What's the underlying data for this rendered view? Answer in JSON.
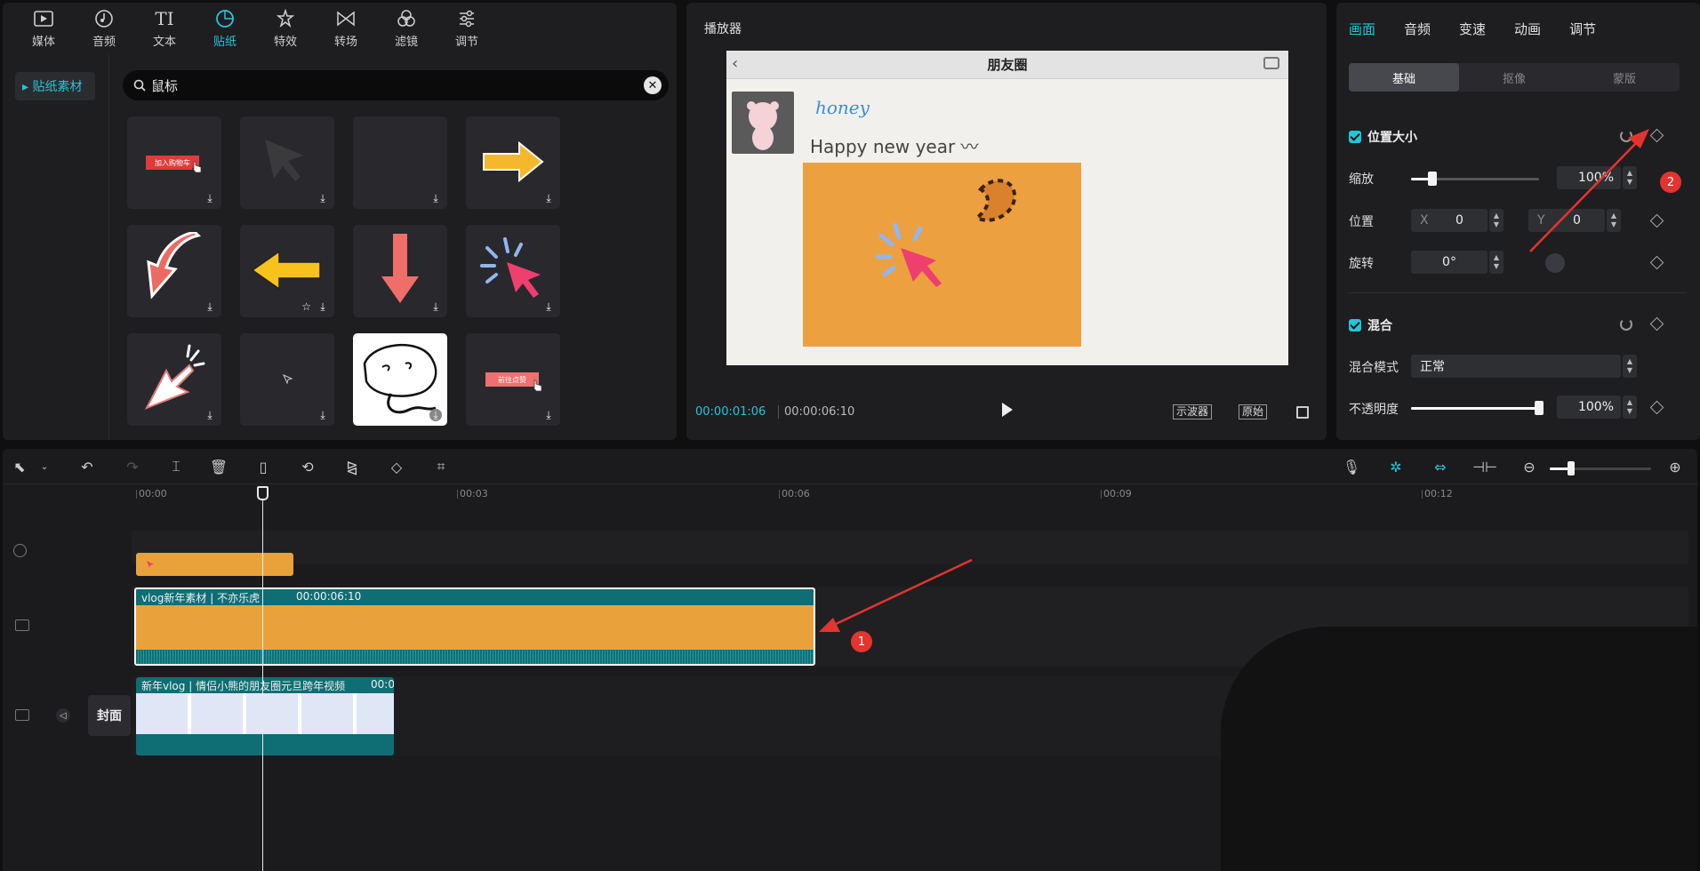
{
  "toolbar": {
    "tools": [
      {
        "label": "媒体",
        "icon": "media-icon"
      },
      {
        "label": "音频",
        "icon": "audio-icon"
      },
      {
        "label": "文本",
        "icon": "text-icon"
      },
      {
        "label": "贴纸",
        "icon": "sticker-icon",
        "active": true
      },
      {
        "label": "特效",
        "icon": "effects-icon"
      },
      {
        "label": "转场",
        "icon": "transition-icon"
      },
      {
        "label": "滤镜",
        "icon": "filter-icon"
      },
      {
        "label": "调节",
        "icon": "adjust-icon"
      }
    ]
  },
  "sidebar": {
    "active_item": "▸ 贴纸素材"
  },
  "search": {
    "query": "鼠标"
  },
  "stickers": {
    "tile_texts": [
      "加入购物车",
      "前往点赞"
    ]
  },
  "player": {
    "title": "播放器",
    "preview": {
      "header": "朋友圈",
      "name": "honey",
      "post_text": "Happy new year 〰"
    },
    "current_time": "00:00:01:06",
    "total_time": "00:00:06:10",
    "btn_scope": "示波器",
    "btn_original": "原始"
  },
  "props": {
    "tabs": [
      "画面",
      "音频",
      "变速",
      "动画",
      "调节"
    ],
    "active_tab": "画面",
    "segments": [
      "基础",
      "抠像",
      "蒙版"
    ],
    "section_position": "位置大小",
    "scale_label": "缩放",
    "scale_value": "100%",
    "scale_level": 0.17,
    "position_label": "位置",
    "x_label": "X",
    "x_value": "0",
    "y_label": "Y",
    "y_value": "0",
    "rotate_label": "旋转",
    "rotate_value": "0°",
    "section_blend": "混合",
    "blend_mode_label": "混合模式",
    "blend_mode_value": "正常",
    "opacity_label": "不透明度",
    "opacity_value": "100%",
    "opacity_level": 1.0
  },
  "timeline": {
    "ruler": [
      "00:00",
      "00:03",
      "00:06",
      "00:09",
      "00:12"
    ],
    "main_clip_label": "vlog新年素材 | 不亦乐虎",
    "main_clip_duration": "00:00:06:10",
    "video_clip_label": "新年vlog | 情侣小熊的朋友圈元旦跨年视频",
    "video_clip_time": "00:0",
    "cover_label": "封面"
  },
  "annotations": {
    "badge_1": "1",
    "badge_2": "2"
  },
  "colors": {
    "accent": "#22c6d7",
    "clip_orange": "#e9a23b",
    "clip_teal": "#0f6e73",
    "badge_red": "#e3342f"
  }
}
